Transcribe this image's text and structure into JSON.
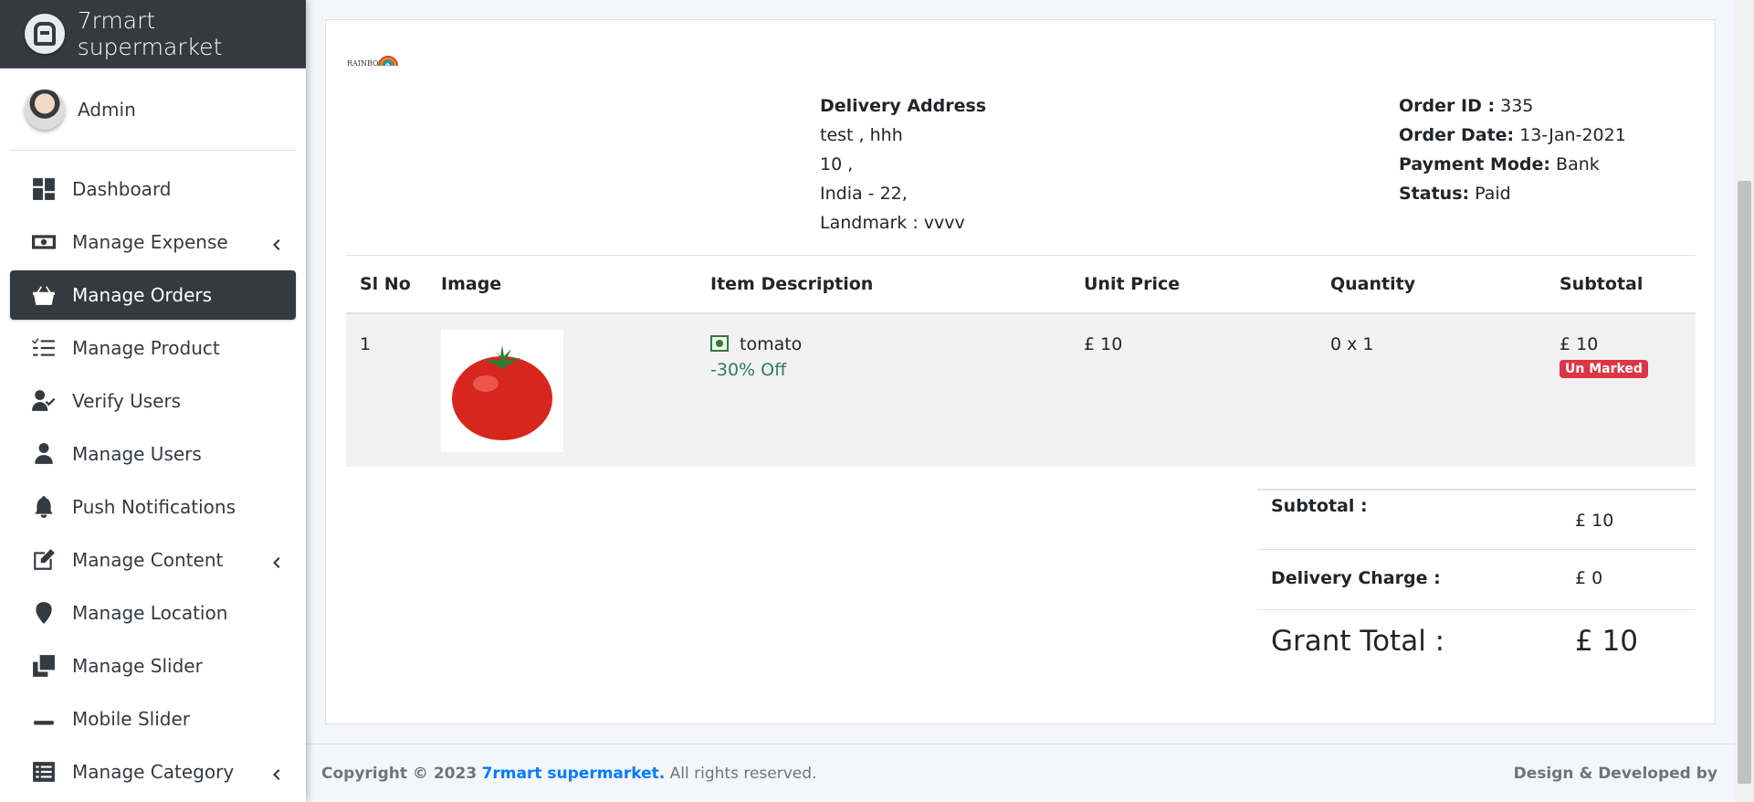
{
  "brand": {
    "name": "7rmart supermarket"
  },
  "user": {
    "name": "Admin"
  },
  "nav": [
    {
      "label": "Dashboard",
      "icon": "dashboard-icon",
      "caret": false,
      "active": false
    },
    {
      "label": "Manage Expense",
      "icon": "money-icon",
      "caret": true,
      "active": false
    },
    {
      "label": "Manage Orders",
      "icon": "basket-icon",
      "caret": false,
      "active": true
    },
    {
      "label": "Manage Product",
      "icon": "tasks-icon",
      "caret": false,
      "active": false
    },
    {
      "label": "Verify Users",
      "icon": "user-check-icon",
      "caret": false,
      "active": false
    },
    {
      "label": "Manage Users",
      "icon": "user-icon",
      "caret": false,
      "active": false
    },
    {
      "label": "Push Notifications",
      "icon": "bell-icon",
      "caret": false,
      "active": false
    },
    {
      "label": "Manage Content",
      "icon": "edit-icon",
      "caret": true,
      "active": false
    },
    {
      "label": "Manage Location",
      "icon": "map-marker-icon",
      "caret": false,
      "active": false
    },
    {
      "label": "Manage Slider",
      "icon": "clone-icon",
      "caret": false,
      "active": false
    },
    {
      "label": "Mobile Slider",
      "icon": "minus-icon",
      "caret": false,
      "active": false
    },
    {
      "label": "Manage Category",
      "icon": "list-alt-icon",
      "caret": true,
      "active": false
    }
  ],
  "address": {
    "heading": "Delivery Address",
    "line1": "test , hhh",
    "line2": "10 ,",
    "line3": "India - 22,",
    "line4": "Landmark : vvvv"
  },
  "order": {
    "id_label": "Order ID :",
    "id_value": "335",
    "date_label": "Order Date:",
    "date_value": "13-Jan-2021",
    "payment_label": "Payment Mode:",
    "payment_value": "Bank",
    "status_label": "Status:",
    "status_value": "Paid"
  },
  "table": {
    "headers": [
      "Sl No",
      "Image",
      "Item Description",
      "Unit Price",
      "Quantity",
      "Subtotal"
    ],
    "rows": [
      {
        "sl": "1",
        "item": "tomato",
        "discount": "-30% Off",
        "unit_price": "£ 10",
        "quantity": "0 x 1",
        "subtotal": "£ 10",
        "badge": "Un Marked"
      }
    ]
  },
  "totals": {
    "subtotal_label": "Subtotal :",
    "subtotal_value": "£ 10",
    "delivery_label": "Delivery Charge :",
    "delivery_value": "£ 0",
    "grand_label": "Grant Total :",
    "grand_value": "£ 10"
  },
  "footer": {
    "copyright": "Copyright © 2023",
    "brand_link": "7rmart supermarket.",
    "rights": "All rights reserved.",
    "right_text": "Design & Developed by"
  },
  "colors": {
    "sidebar_active": "#343a40",
    "badge": "#dc3545",
    "link": "#007bff",
    "discount": "#2e7d5b"
  }
}
